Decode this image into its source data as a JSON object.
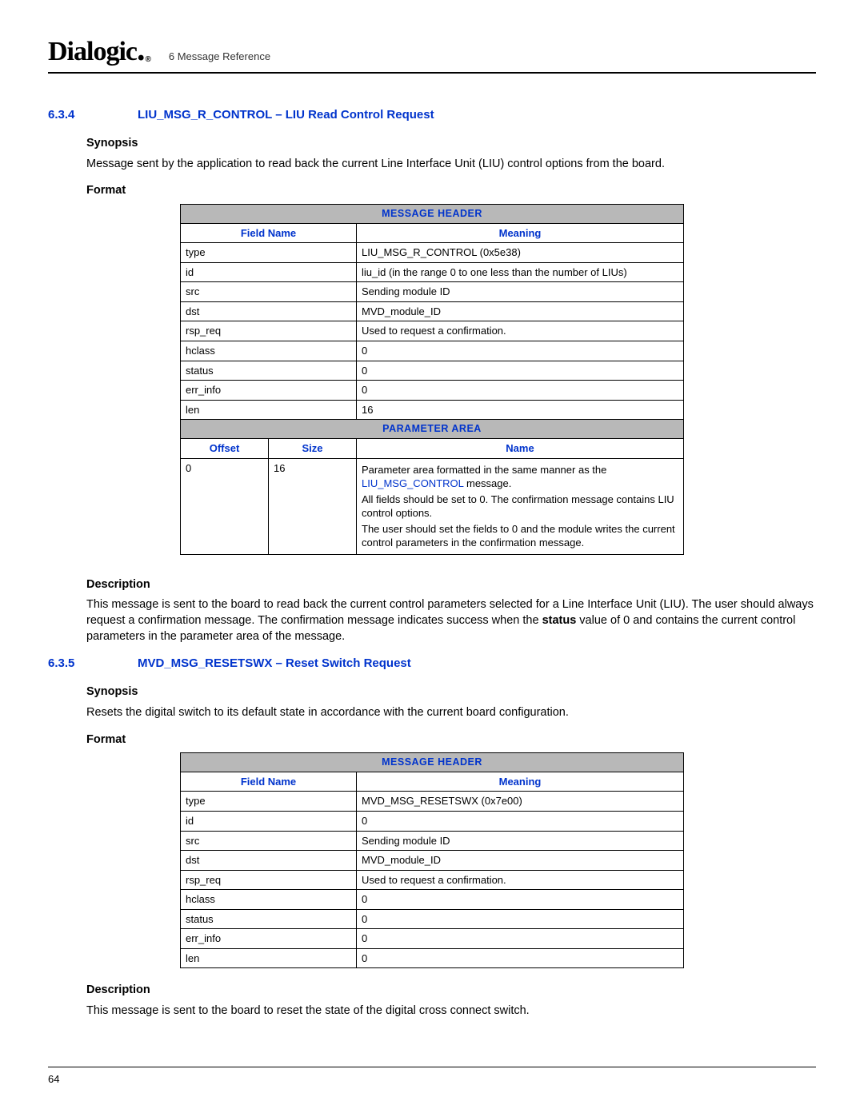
{
  "header": {
    "logo": "Dialogic",
    "reg": "®",
    "crumb": "6 Message Reference"
  },
  "page_number": "64",
  "sec1": {
    "num": "6.3.4",
    "title": "LIU_MSG_R_CONTROL – LIU Read Control Request",
    "synopsis_h": "Synopsis",
    "synopsis": "Message sent by the application to read back the current Line Interface Unit (LIU) control options from the board.",
    "format_h": "Format",
    "table": {
      "band1": "MESSAGE HEADER",
      "h_field": "Field Name",
      "h_meaning": "Meaning",
      "rows": [
        {
          "f": "type",
          "m": "LIU_MSG_R_CONTROL (0x5e38)"
        },
        {
          "f": "id",
          "m": "liu_id (in the range 0 to one less than the number of LIUs)"
        },
        {
          "f": "src",
          "m": "Sending module ID"
        },
        {
          "f": "dst",
          "m": "MVD_module_ID"
        },
        {
          "f": "rsp_req",
          "m": "Used to request a confirmation."
        },
        {
          "f": "hclass",
          "m": "0"
        },
        {
          "f": "status",
          "m": "0"
        },
        {
          "f": "err_info",
          "m": "0"
        },
        {
          "f": "len",
          "m": "16"
        }
      ],
      "band2": "PARAMETER AREA",
      "h_offset": "Offset",
      "h_size": "Size",
      "h_name": "Name",
      "p_offset": "0",
      "p_size": "16",
      "p_text1a": "Parameter area formatted in the same manner as the ",
      "p_text1b": "LIU_MSG_CONTROL",
      "p_text1c": " message.",
      "p_text2": "All fields should be set to 0. The confirmation message contains LIU control options.",
      "p_text3": "The user should set the fields to 0 and the module writes the current control parameters in the confirmation message."
    },
    "description_h": "Description",
    "description_a": "This message is sent to the board to read back the current control parameters selected for a Line Interface Unit (LIU). The user should always request a confirmation message. The confirmation message indicates success when the ",
    "description_b": "status",
    "description_c": " value of 0 and contains the current control parameters in the parameter area of the message."
  },
  "sec2": {
    "num": "6.3.5",
    "title": "MVD_MSG_RESETSWX – Reset Switch Request",
    "synopsis_h": "Synopsis",
    "synopsis": "Resets the digital switch to its default state in accordance with the current board configuration.",
    "format_h": "Format",
    "table": {
      "band1": "MESSAGE HEADER",
      "h_field": "Field Name",
      "h_meaning": "Meaning",
      "rows": [
        {
          "f": "type",
          "m": "MVD_MSG_RESETSWX (0x7e00)"
        },
        {
          "f": "id",
          "m": "0"
        },
        {
          "f": "src",
          "m": "Sending module ID"
        },
        {
          "f": "dst",
          "m": "MVD_module_ID"
        },
        {
          "f": "rsp_req",
          "m": "Used to request a confirmation."
        },
        {
          "f": "hclass",
          "m": "0"
        },
        {
          "f": "status",
          "m": "0"
        },
        {
          "f": "err_info",
          "m": "0"
        },
        {
          "f": "len",
          "m": "0"
        }
      ]
    },
    "description_h": "Description",
    "description": "This message is sent to the board to reset the state of the digital cross connect switch."
  }
}
